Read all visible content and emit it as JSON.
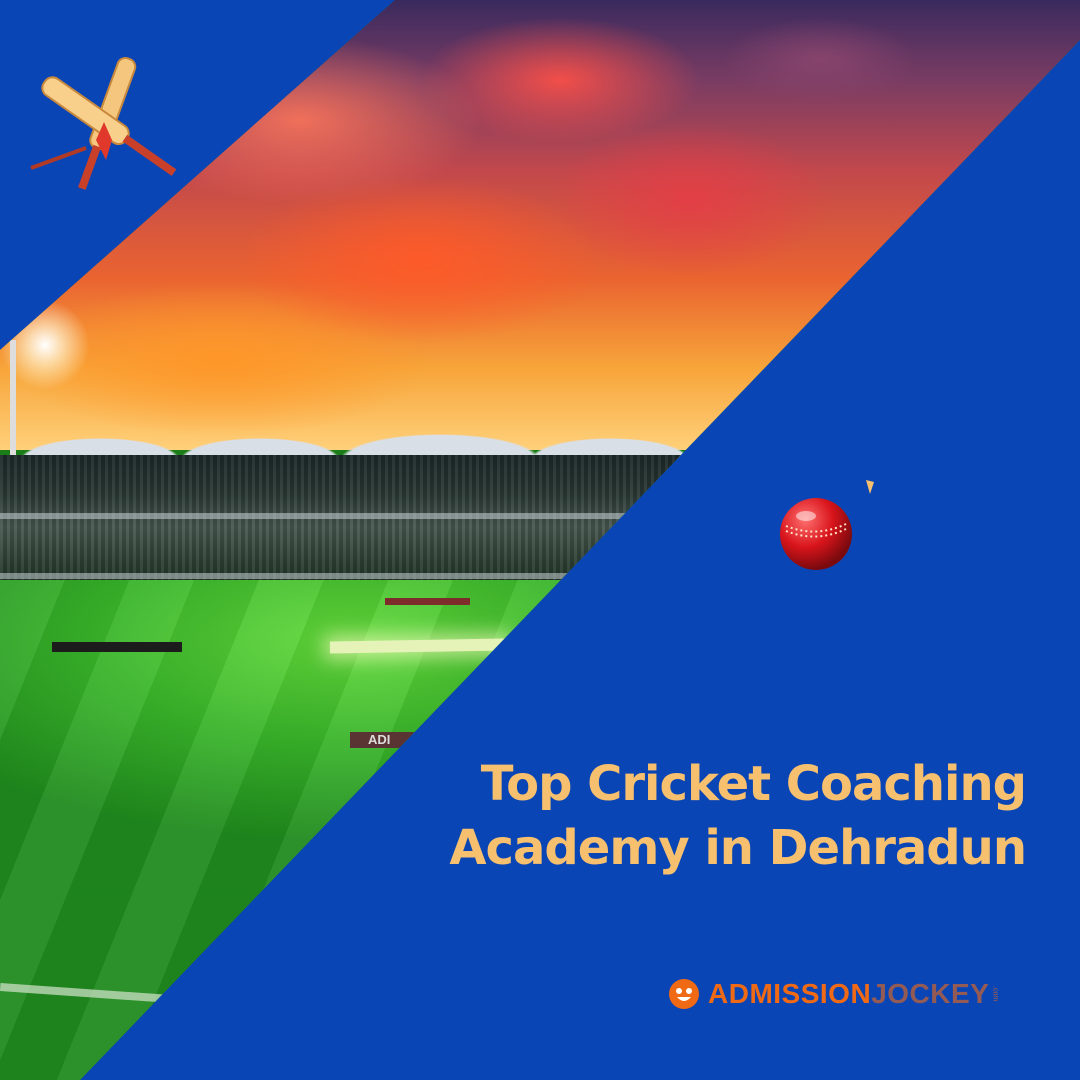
{
  "headline": {
    "line1": "Top Cricket Coaching",
    "line2": "Academy in Dehradun"
  },
  "brand": {
    "name_strong": "ADMISSION",
    "name_light": "JOCKEY",
    "suffix": ".com"
  },
  "photo": {
    "ad_board_text": "ADI"
  },
  "icons": {
    "top_left": "cricket-bats-stumps-icon",
    "ball": "cricket-ball-icon",
    "logo": "smiley-face-icon"
  },
  "colors": {
    "background": "#0a45b5",
    "headline": "#f7c06e",
    "brand": "#f06a16",
    "ball": "#d8141b"
  }
}
